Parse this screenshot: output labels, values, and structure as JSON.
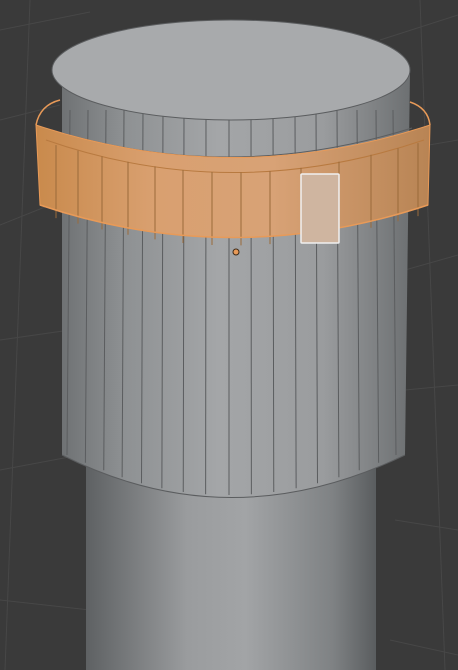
{
  "viewport": {
    "name": "3d-viewport",
    "mode": "edit-mode-face-select",
    "background_color": "#3a3a3a",
    "grid_color": "#474747"
  },
  "model": {
    "object": "cylinder-mesh",
    "base_color": "#9c9e9f",
    "edge_color": "#5b5d5f",
    "selection_color": "#e89a58",
    "active_face_color": "#f0f0f0"
  }
}
